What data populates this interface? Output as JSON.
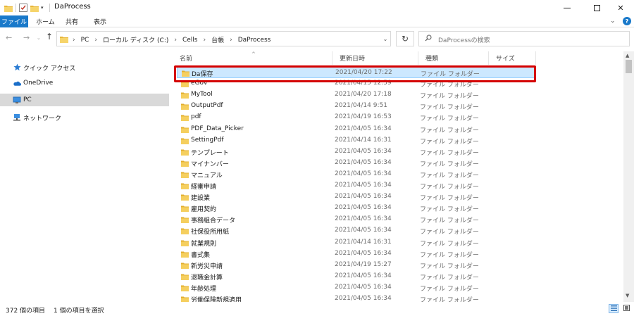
{
  "window": {
    "title": "DaProcess",
    "quick_access_caret": "▾",
    "minimize_label": "",
    "maximize_label": "",
    "close_label": "✕"
  },
  "ribbon": {
    "tabs": [
      "ファイル",
      "ホーム",
      "共有",
      "表示"
    ],
    "expand_icon": "⌄",
    "help_label": "?"
  },
  "address": {
    "back": "←",
    "forward": "→",
    "recent": "⌄",
    "up": "↑",
    "crumbs": [
      "PC",
      "ローカル ディスク (C:)",
      "Cells",
      "台帳",
      "DaProcess"
    ],
    "separator": "›",
    "dropdown": "⌄",
    "refresh": "↻"
  },
  "search": {
    "placeholder": "DaProcessの検索",
    "icon": "⌕"
  },
  "navpane": {
    "items": [
      {
        "label": "クイック アクセス",
        "icon": "star-icon"
      },
      {
        "label": "OneDrive",
        "icon": "cloud-icon"
      },
      {
        "label": "PC",
        "icon": "computer-icon",
        "selected": true
      },
      {
        "label": "ネットワーク",
        "icon": "network-icon"
      }
    ]
  },
  "columns": {
    "name": "名前",
    "date": "更新日時",
    "type": "種類",
    "size": "サイズ",
    "sort_indicator": "^"
  },
  "files": [
    {
      "name": "Da保存",
      "date": "2021/04/20 17:22",
      "type": "ファイル フォルダー",
      "selected": true
    },
    {
      "name": "eGov",
      "date": "2021/04/15 12:59",
      "type": "ファイル フォルダー"
    },
    {
      "name": "MyTool",
      "date": "2021/04/20 17:18",
      "type": "ファイル フォルダー"
    },
    {
      "name": "OutputPdf",
      "date": "2021/04/14 9:51",
      "type": "ファイル フォルダー"
    },
    {
      "name": "pdf",
      "date": "2021/04/19 16:53",
      "type": "ファイル フォルダー"
    },
    {
      "name": "PDF_Data_Picker",
      "date": "2021/04/05 16:34",
      "type": "ファイル フォルダー"
    },
    {
      "name": "SettingPdf",
      "date": "2021/04/14 16:31",
      "type": "ファイル フォルダー"
    },
    {
      "name": "テンプレート",
      "date": "2021/04/05 16:34",
      "type": "ファイル フォルダー"
    },
    {
      "name": "マイナンバー",
      "date": "2021/04/05 16:34",
      "type": "ファイル フォルダー"
    },
    {
      "name": "マニュアル",
      "date": "2021/04/05 16:34",
      "type": "ファイル フォルダー"
    },
    {
      "name": "経審申請",
      "date": "2021/04/05 16:34",
      "type": "ファイル フォルダー"
    },
    {
      "name": "建設業",
      "date": "2021/04/05 16:34",
      "type": "ファイル フォルダー"
    },
    {
      "name": "雇用契約",
      "date": "2021/04/05 16:34",
      "type": "ファイル フォルダー"
    },
    {
      "name": "事務組合データ",
      "date": "2021/04/05 16:34",
      "type": "ファイル フォルダー"
    },
    {
      "name": "社保役所用紙",
      "date": "2021/04/05 16:34",
      "type": "ファイル フォルダー"
    },
    {
      "name": "就業規則",
      "date": "2021/04/14 16:31",
      "type": "ファイル フォルダー"
    },
    {
      "name": "書式集",
      "date": "2021/04/05 16:34",
      "type": "ファイル フォルダー"
    },
    {
      "name": "新労災申請",
      "date": "2021/04/19 15:27",
      "type": "ファイル フォルダー"
    },
    {
      "name": "退職金計算",
      "date": "2021/04/05 16:34",
      "type": "ファイル フォルダー"
    },
    {
      "name": "年齢処理",
      "date": "2021/04/05 16:34",
      "type": "ファイル フォルダー"
    },
    {
      "name": "労働保険新規適用",
      "date": "2021/04/05 16:34",
      "type": "ファイル フォルダー"
    }
  ],
  "status": {
    "item_count": "372 個の項目",
    "selection": "1 個の項目を選択"
  },
  "colors": {
    "accent": "#1979ca",
    "selection_fill": "#cce8ff",
    "selection_border": "#99d1ff",
    "highlight": "#d40000",
    "folder": "#f0c43a"
  }
}
